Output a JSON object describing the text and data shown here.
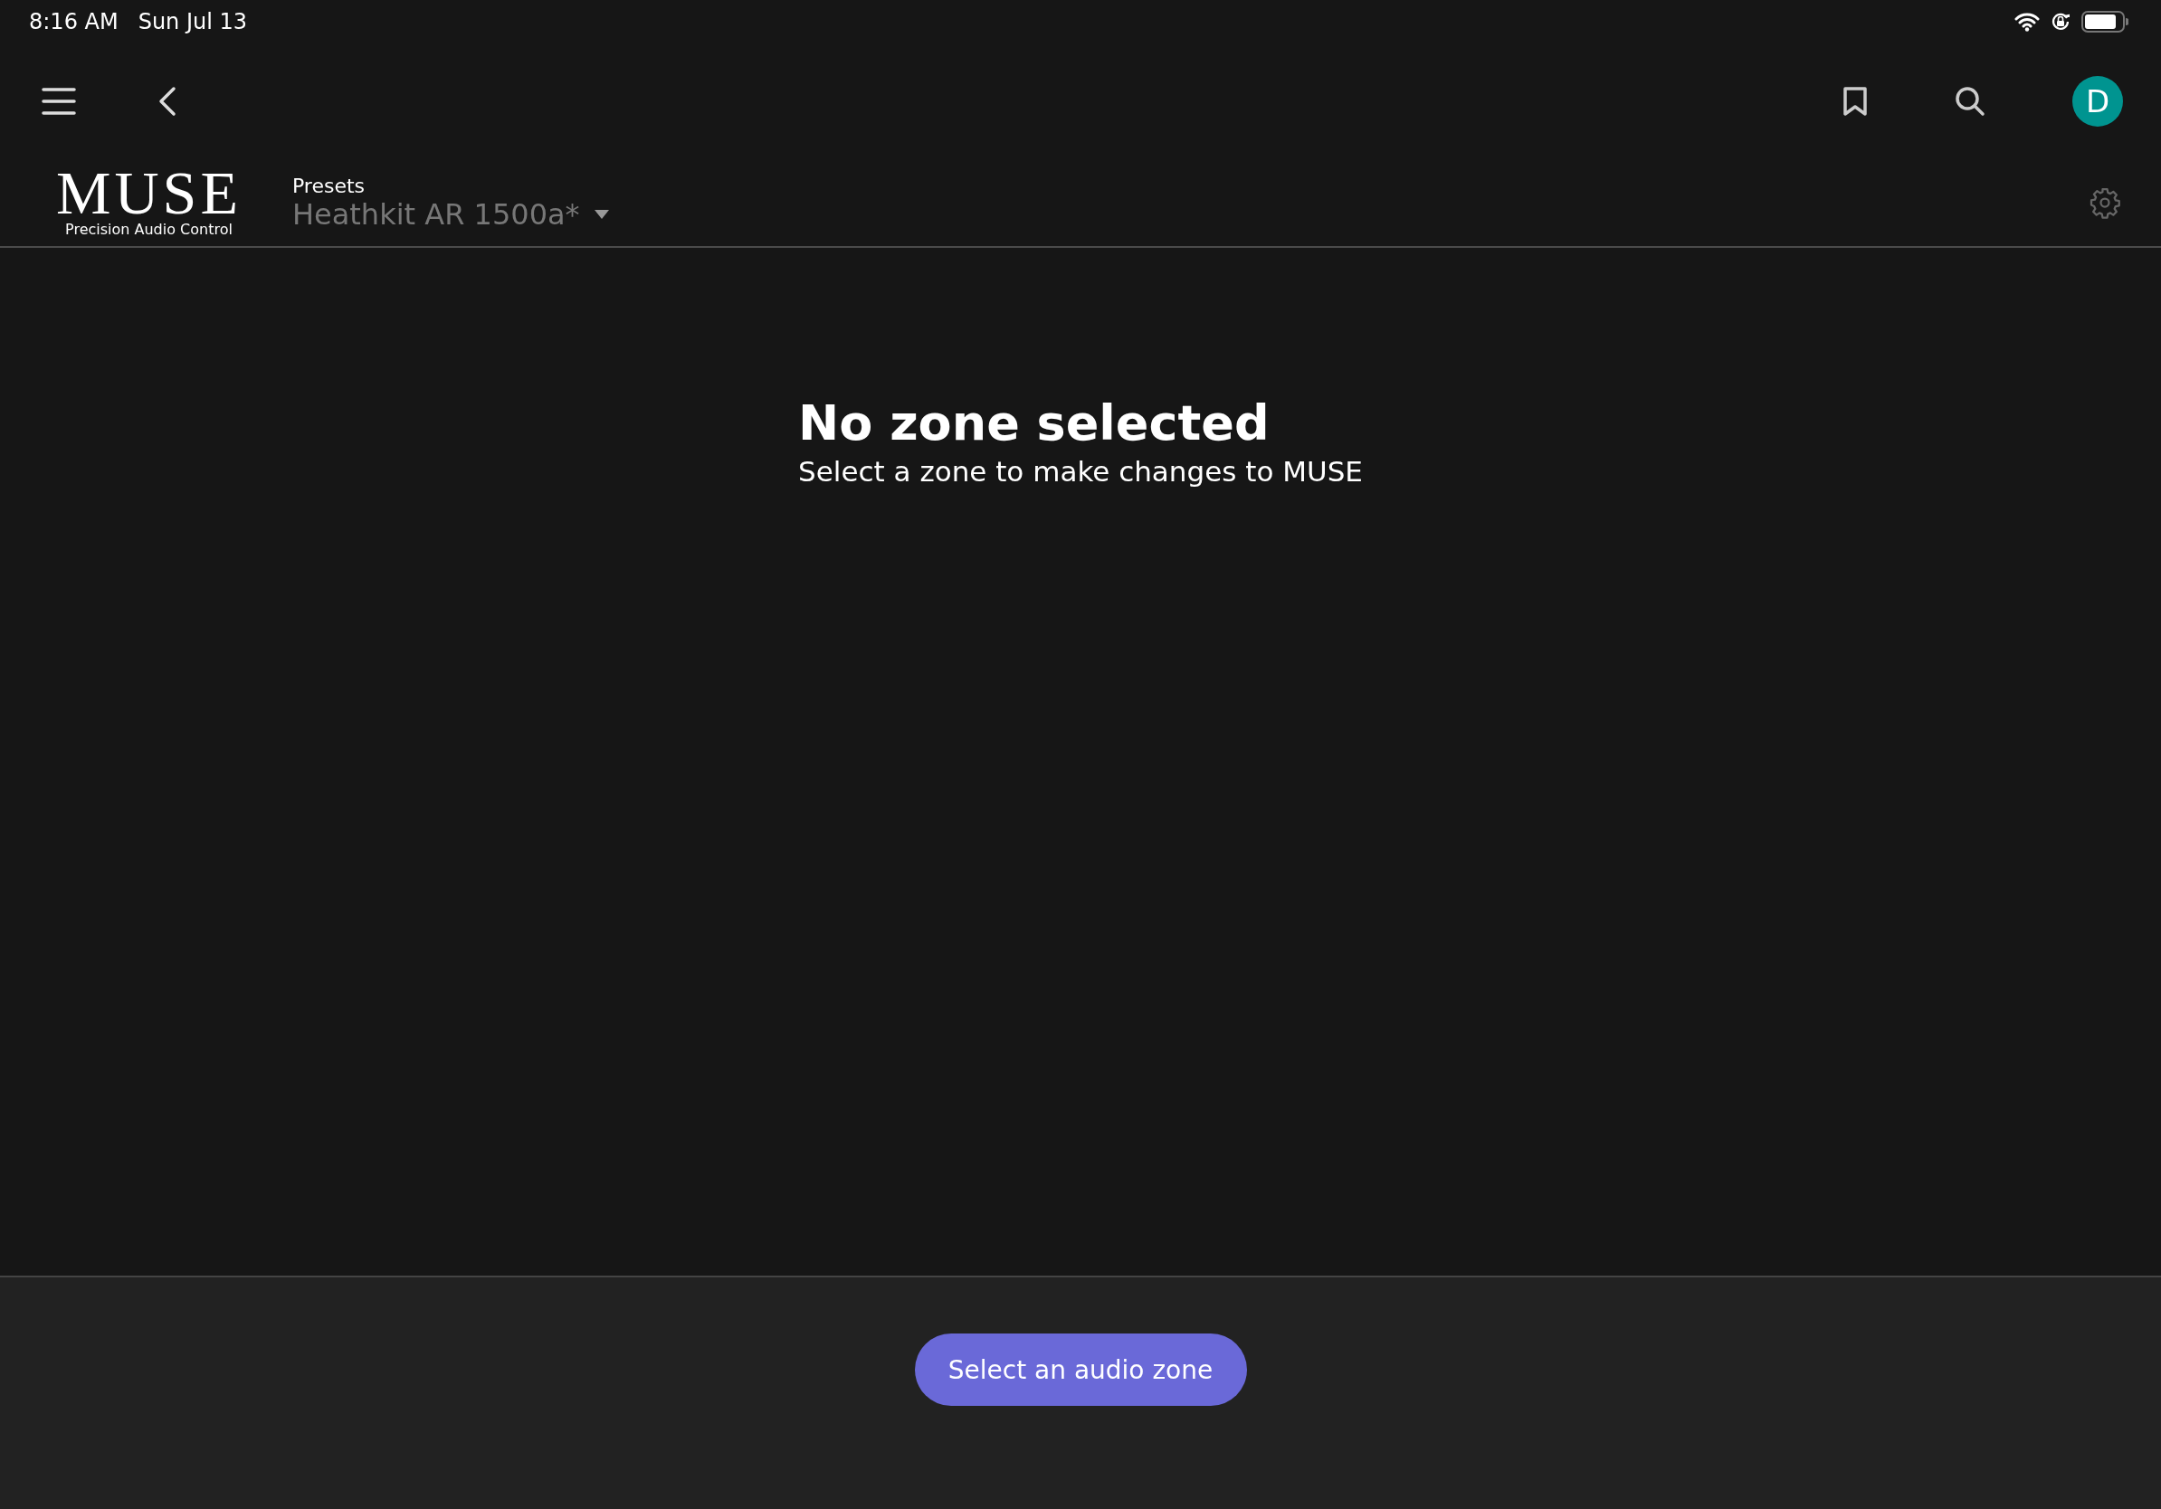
{
  "status_bar": {
    "time": "8:16 AM",
    "date": "Sun Jul 13"
  },
  "toolbar": {
    "avatar": {
      "initial": "D",
      "color": "#009490"
    }
  },
  "header": {
    "logo_title": "MUSE",
    "logo_subtitle": "Precision Audio Control",
    "presets_label": "Presets",
    "preset_value": "Heathkit AR 1500a*"
  },
  "empty_state": {
    "title": "No zone selected",
    "message": "Select a zone to make changes to MUSE"
  },
  "footer": {
    "button": "Select an audio zone"
  }
}
